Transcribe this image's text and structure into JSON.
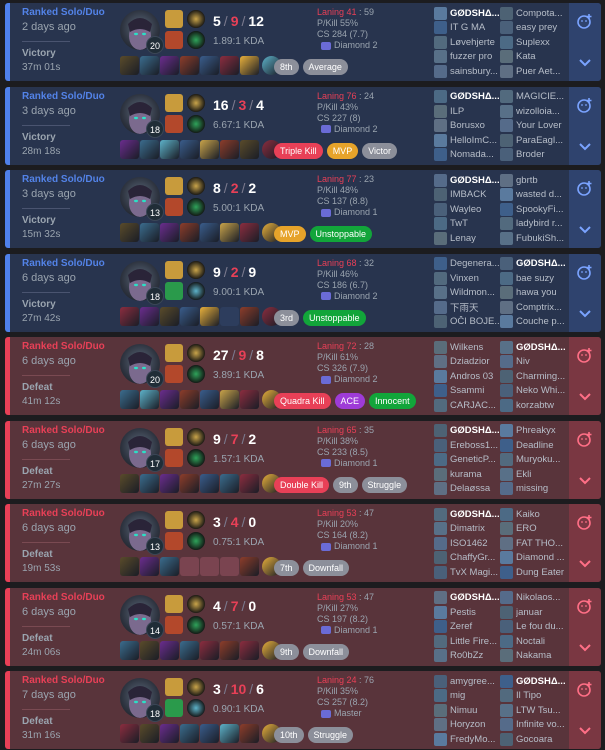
{
  "colors": {
    "win": "#5383e8",
    "loss": "#e84057"
  },
  "matches": [
    {
      "queue": "Ranked Solo/Duo",
      "ago": "2 days ago",
      "result": "Victory",
      "duration": "37m 01s",
      "level": "20",
      "k": "5",
      "d": "9",
      "a": "12",
      "kda": "1.89:1 KDA",
      "laning": "Laning 41",
      "laning_opp": " : 59",
      "pkill": "P/Kill 55%",
      "cs": "CS 284 (7.7)",
      "rank": "Diamond 2",
      "spells": [
        "#c89b3c",
        "#b3482b"
      ],
      "runes": [
        "#c9a44a",
        "#2fa35a"
      ],
      "items": [
        "#5a4b2a",
        "#3b6d8e",
        "#6b2d8e",
        "#8d3d2a",
        "#3a5d8c",
        "#8c2d3f",
        "#e8b03b",
        "#5db2c9"
      ],
      "badges": [
        {
          "t": "8th",
          "c": "b-grey"
        },
        {
          "t": "Average",
          "c": "b-grey"
        }
      ],
      "team1": [
        "GØDSHΔ...",
        "IT G MA",
        "Løvehjerte",
        "fuzzer pro",
        "sainsbury..."
      ],
      "team2": [
        "Compota...",
        "easy prey",
        "Suplexx",
        "Kata",
        "Puer Aet..."
      ],
      "me_team": 1,
      "me_index": 0
    },
    {
      "queue": "Ranked Solo/Duo",
      "ago": "3 days ago",
      "result": "Victory",
      "duration": "28m 18s",
      "level": "18",
      "k": "16",
      "d": "3",
      "a": "4",
      "kda": "6.67:1 KDA",
      "laning": "Laning 76",
      "laning_opp": " : 24",
      "pkill": "P/Kill 43%",
      "cs": "CS 227 (8)",
      "rank": "Diamond 2",
      "spells": [
        "#c89b3c",
        "#b3482b"
      ],
      "runes": [
        "#c9a44a",
        "#2fa35a"
      ],
      "items": [
        "#6b2d8e",
        "#3b6d8e",
        "#5db2c9",
        "#3a5d8c",
        "#c9a44a",
        "#8d3d2a",
        "#5a4b2a",
        "#8c2d3f"
      ],
      "badges": [
        {
          "t": "Triple Kill",
          "c": "b-red"
        },
        {
          "t": "MVP",
          "c": "b-orange"
        },
        {
          "t": "Victor",
          "c": "b-grey"
        }
      ],
      "team1": [
        "GØDSHΔ...",
        "ILP",
        "Borusxo",
        "HelloImC...",
        "Nomada..."
      ],
      "team2": [
        "MAGICIE...",
        "wizolloia...",
        "Your Lover",
        "ParaEagl...",
        "Broder"
      ],
      "me_team": 1,
      "me_index": 0
    },
    {
      "queue": "Ranked Solo/Duo",
      "ago": "3 days ago",
      "result": "Victory",
      "duration": "15m 32s",
      "level": "13",
      "k": "8",
      "d": "2",
      "a": "2",
      "kda": "5.00:1 KDA",
      "laning": "Laning 77",
      "laning_opp": " : 23",
      "pkill": "P/Kill 48%",
      "cs": "CS 137 (8.8)",
      "rank": "Diamond 1",
      "spells": [
        "#c89b3c",
        "#b3482b"
      ],
      "runes": [
        "#c9a44a",
        "#2fa35a"
      ],
      "items": [
        "#5a4b2a",
        "#3b6d8e",
        "#6b2d8e",
        "#8d3d2a",
        "#3a5d8c",
        "#c9a44a",
        "#8c2d3f",
        "#e8b03b"
      ],
      "badges": [
        {
          "t": "MVP",
          "c": "b-orange"
        },
        {
          "t": "Unstoppable",
          "c": "b-green"
        }
      ],
      "team1": [
        "GØDSHΔ...",
        "IMBACK",
        "Wayleo",
        "TwT",
        "Lenay"
      ],
      "team2": [
        "gbrtb",
        "wasted d...",
        "SpookyFi...",
        "ladybird r...",
        "FubukiSh..."
      ],
      "me_team": 1,
      "me_index": 0
    },
    {
      "queue": "Ranked Solo/Duo",
      "ago": "6 days ago",
      "result": "Victory",
      "duration": "27m 42s",
      "level": "18",
      "k": "9",
      "d": "2",
      "a": "9",
      "kda": "9.00:1 KDA",
      "laning": "Laning 68",
      "laning_opp": " : 32",
      "pkill": "P/Kill 46%",
      "cs": "CS 186 (6.7)",
      "rank": "Diamond 2",
      "spells": [
        "#c89b3c",
        "#2a9a4b"
      ],
      "runes": [
        "#c9a44a",
        "#5db2c9"
      ],
      "items": [
        "#8c2d3f",
        "#6b2d8e",
        "#5a4b2a",
        "#3a5d8c",
        "#e8b03b",
        "empty",
        "#8d3d2a",
        "#8c2d3f"
      ],
      "badges": [
        {
          "t": "3rd",
          "c": "b-grey"
        },
        {
          "t": "Unstoppable",
          "c": "b-green"
        }
      ],
      "team1": [
        "Degenera...",
        "Vinxen",
        "Wildmon...",
        "下雨天",
        "OČI BOJE..."
      ],
      "team2": [
        "GØDSHΔ...",
        "bae suzy",
        "hawa you",
        "Comptrix...",
        "Couche p..."
      ],
      "me_team": 2,
      "me_index": 0
    },
    {
      "queue": "Ranked Solo/Duo",
      "ago": "6 days ago",
      "result": "Defeat",
      "duration": "41m 12s",
      "level": "20",
      "k": "27",
      "d": "9",
      "a": "8",
      "kda": "3.89:1 KDA",
      "laning": "Laning 72",
      "laning_opp": " : 28",
      "pkill": "P/Kill 61%",
      "cs": "CS 326 (7.9)",
      "rank": "Diamond 2",
      "spells": [
        "#c89b3c",
        "#b3482b"
      ],
      "runes": [
        "#c9a44a",
        "#2fa35a"
      ],
      "items": [
        "#3b6d8e",
        "#5db2c9",
        "#6b2d8e",
        "#8d3d2a",
        "#3a5d8c",
        "#c9a44a",
        "#8c2d3f",
        "#e8b03b"
      ],
      "badges": [
        {
          "t": "Quadra Kill",
          "c": "b-red"
        },
        {
          "t": "ACE",
          "c": "b-purple"
        },
        {
          "t": "Innocent",
          "c": "b-green"
        }
      ],
      "team1": [
        "Wilkens",
        "Dziadzior",
        "Andros 03",
        "Ssammi",
        "CARJAC..."
      ],
      "team2": [
        "GØDSHΔ...",
        "Niv",
        "Charming...",
        "Neko Whi...",
        "korzabtw"
      ],
      "me_team": 2,
      "me_index": 0
    },
    {
      "queue": "Ranked Solo/Duo",
      "ago": "6 days ago",
      "result": "Defeat",
      "duration": "27m 27s",
      "level": "17",
      "k": "9",
      "d": "7",
      "a": "2",
      "kda": "1.57:1 KDA",
      "laning": "Laning 65",
      "laning_opp": " : 35",
      "pkill": "P/Kill 38%",
      "cs": "CS 233 (8.5)",
      "rank": "Diamond 1",
      "spells": [
        "#c89b3c",
        "#b3482b"
      ],
      "runes": [
        "#c9a44a",
        "#2fa35a"
      ],
      "items": [
        "#5a4b2a",
        "#3b6d8e",
        "#6b2d8e",
        "#8d3d2a",
        "#3a5d8c",
        "#3b6d8e",
        "#8c2d3f",
        "#e8b03b"
      ],
      "badges": [
        {
          "t": "Double Kill",
          "c": "b-red"
        },
        {
          "t": "9th",
          "c": "b-grey"
        },
        {
          "t": "Struggle",
          "c": "b-grey"
        }
      ],
      "team1": [
        "GØDSHΔ...",
        "Ereboss1...",
        "GeneticP...",
        "kurama",
        "Delaøssa"
      ],
      "team2": [
        "Phreakyx",
        "Deadline",
        "Muryoku...",
        "Ekli",
        "missing"
      ],
      "me_team": 1,
      "me_index": 0
    },
    {
      "queue": "Ranked Solo/Duo",
      "ago": "6 days ago",
      "result": "Defeat",
      "duration": "19m 53s",
      "level": "13",
      "k": "3",
      "d": "4",
      "a": "0",
      "kda": "0.75:1 KDA",
      "laning": "Laning 53",
      "laning_opp": " : 47",
      "pkill": "P/Kill 20%",
      "cs": "CS 164 (8.2)",
      "rank": "Diamond 1",
      "spells": [
        "#c89b3c",
        "#b3482b"
      ],
      "runes": [
        "#c9a44a",
        "#2fa35a"
      ],
      "items": [
        "#5a4b2a",
        "#6b2d8e",
        "#3b6d8e",
        "empty",
        "empty",
        "empty",
        "#8d3d2a",
        "#e8b03b"
      ],
      "badges": [
        {
          "t": "7th",
          "c": "b-grey"
        },
        {
          "t": "Downfall",
          "c": "b-grey"
        }
      ],
      "team1": [
        "GØDSHΔ...",
        "Dimatrix",
        "ISO1462",
        "ChaffyGr...",
        "TvX Magi..."
      ],
      "team2": [
        "Kaiko",
        "ERO",
        "FAT THO...",
        "Diamond ...",
        "Dung Eater"
      ],
      "me_team": 1,
      "me_index": 0
    },
    {
      "queue": "Ranked Solo/Duo",
      "ago": "6 days ago",
      "result": "Defeat",
      "duration": "24m 06s",
      "level": "14",
      "k": "4",
      "d": "7",
      "a": "0",
      "kda": "0.57:1 KDA",
      "laning": "Laning 53",
      "laning_opp": " : 47",
      "pkill": "P/Kill 27%",
      "cs": "CS 197 (8.2)",
      "rank": "Diamond 1",
      "spells": [
        "#c89b3c",
        "#b3482b"
      ],
      "runes": [
        "#c9a44a",
        "#2fa35a"
      ],
      "items": [
        "#3b6d8e",
        "#5a4b2a",
        "#6b2d8e",
        "#3b6d8e",
        "#8c2d3f",
        "#8d3d2a",
        "#8c2d3f",
        "#e8b03b"
      ],
      "badges": [
        {
          "t": "9th",
          "c": "b-grey"
        },
        {
          "t": "Downfall",
          "c": "b-grey"
        }
      ],
      "team1": [
        "GØDSHΔ...",
        "Pestis",
        "Zeref",
        "Little Fire...",
        "Ro0bZz"
      ],
      "team2": [
        "Nikolaos...",
        "januar",
        "Le fou du...",
        "Noctali",
        "Nakama"
      ],
      "me_team": 1,
      "me_index": 0
    },
    {
      "queue": "Ranked Solo/Duo",
      "ago": "7 days ago",
      "result": "Defeat",
      "duration": "31m 16s",
      "level": "18",
      "k": "3",
      "d": "10",
      "a": "6",
      "kda": "0.90:1 KDA",
      "laning": "Laning 24",
      "laning_opp": " : 76",
      "pkill": "P/Kill 35%",
      "cs": "CS 257 (8.2)",
      "rank": "Master",
      "spells": [
        "#c89b3c",
        "#2a9a4b"
      ],
      "runes": [
        "#c9a44a",
        "#5db2c9"
      ],
      "items": [
        "#8c2d3f",
        "#5a4b2a",
        "#6b2d8e",
        "#3b6d8e",
        "#3a5d8c",
        "#5db2c9",
        "#8d3d2a",
        "#e8b03b"
      ],
      "badges": [
        {
          "t": "10th",
          "c": "b-grey"
        },
        {
          "t": "Struggle",
          "c": "b-grey"
        }
      ],
      "team1": [
        "amygree...",
        "mig",
        "Nimuu",
        "Horyzon",
        "FredyMo..."
      ],
      "team2": [
        "GØDSHΔ...",
        "Il Tipo",
        "LTW Tsu...",
        "Infinite vo...",
        "Gocoara"
      ],
      "me_team": 2,
      "me_index": 0
    }
  ]
}
